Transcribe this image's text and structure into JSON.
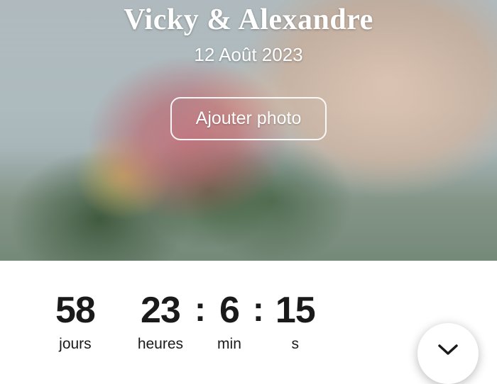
{
  "header": {
    "couple_names": "Vicky & Alexandre",
    "wedding_date": "12 Août 2023"
  },
  "actions": {
    "add_photo_label": "Ajouter photo"
  },
  "countdown": {
    "days": {
      "value": "58",
      "label": "jours"
    },
    "hours": {
      "value": "23",
      "label": "heures"
    },
    "minutes": {
      "value": "6",
      "label": "min"
    },
    "seconds": {
      "value": "15",
      "label": "s"
    },
    "separator": ":"
  }
}
